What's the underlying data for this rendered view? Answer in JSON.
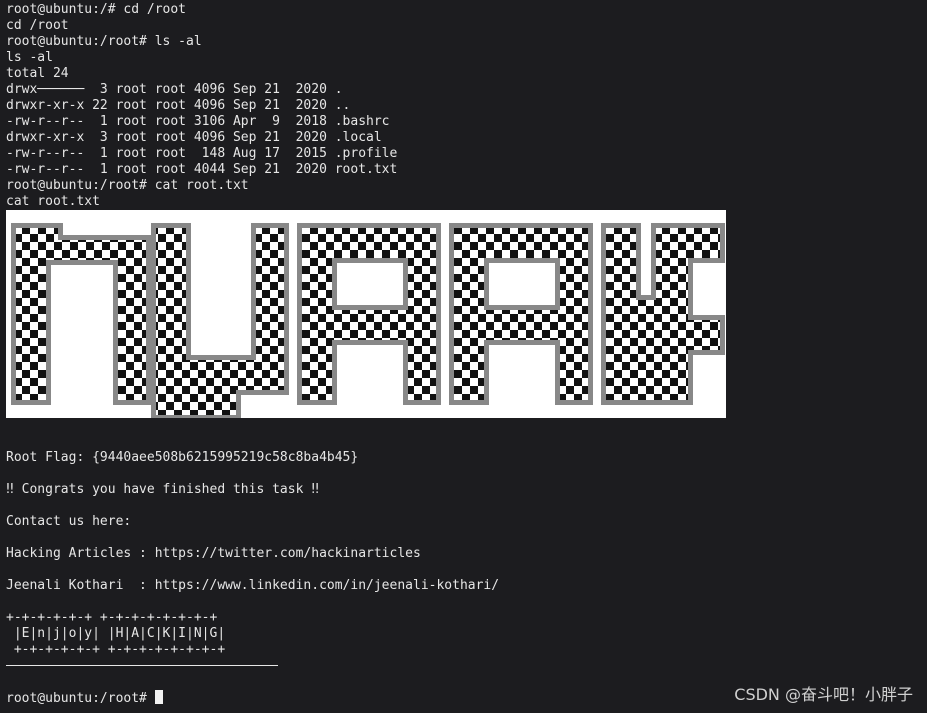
{
  "terminal": {
    "lines_before_art": [
      "root@ubuntu:/# cd /root",
      "cd /root",
      "root@ubuntu:/root# ls -al",
      "ls -al",
      "total 24",
      "drwx──────  3 root root 4096 Sep 21  2020 .",
      "drwxr-xr-x 22 root root 4096 Sep 21  2020 ..",
      "-rw-r--r--  1 root root 3106 Apr  9  2018 .bashrc",
      "drwxr-xr-x  3 root root 4096 Sep 21  2020 .local",
      "-rw-r--r--  1 root root  148 Aug 17  2015 .profile",
      "-rw-r--r--  1 root root 4044 Sep 21  2020 root.txt",
      "root@ubuntu:/root# cat root.txt",
      "cat root.txt"
    ],
    "ascii_art_text": "NARAK",
    "flag_line": "Root Flag: {9440aee508b6215995219c58c8ba4b45}",
    "congrats_line": "‼ Congrats you have finished this task ‼",
    "contact_line": "Contact us here:",
    "hacking_articles_line": "Hacking Articles : https://twitter.com/hackinarticles",
    "jeenali_line": "Jeenali Kothari  : https://www.linkedin.com/in/jeenali-kothari/",
    "banner_lines": [
      "+-+-+-+-+-+ +-+-+-+-+-+-+-+",
      " |E|n|j|o|y| |H|A|C|K|I|N|G|",
      " +-+-+-+-+-+ +-+-+-+-+-+-+-+"
    ],
    "prompt": "root@ubuntu:/root# "
  },
  "watermark": "CSDN @奋斗吧！小胖子",
  "colors": {
    "background": "#1c1c1f",
    "text": "#e6e6e6",
    "art_background": "#ffffff",
    "art_ink": "#111111"
  }
}
